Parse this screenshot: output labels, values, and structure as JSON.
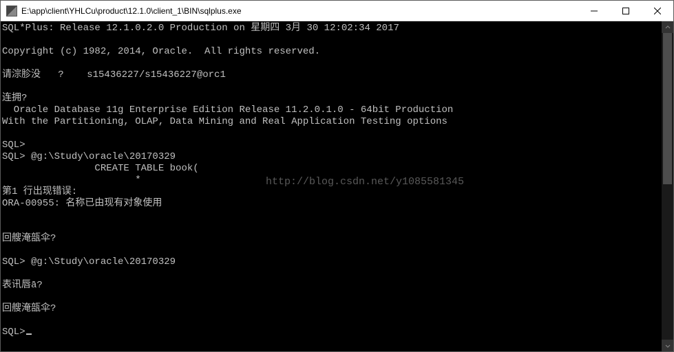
{
  "window": {
    "title": "E:\\app\\client\\YHLCu\\product\\12.1.0\\client_1\\BIN\\sqlplus.exe"
  },
  "watermark": "http://blog.csdn.net/y1085581345",
  "lines": {
    "l0": "SQL*Plus: Release 12.1.0.2.0 Production on 星期四 3月 30 12:02:34 2017",
    "l1": "",
    "l2": "Copyright (c) 1982, 2014, Oracle.  All rights reserved.",
    "l3": "",
    "l4": "请淙胗没   ?    s15436227/s15436227@orc1",
    "l5": "",
    "l6": "连拥?",
    "l7": "  Oracle Database 11g Enterprise Edition Release 11.2.0.1.0 - 64bit Production",
    "l8": "With the Partitioning, OLAP, Data Mining and Real Application Testing options",
    "l9": "",
    "l10": "SQL>",
    "l11": "SQL> @g:\\Study\\oracle\\20170329",
    "l12": "                CREATE TABLE book(",
    "l13": "                       *",
    "l14": "第1 行出现错误:",
    "l15": "ORA-00955: 名称已由现有对象使用",
    "l16": "",
    "l17": "",
    "l18": "回艘淹瓿伞?",
    "l19": "",
    "l20": "SQL> @g:\\Study\\oracle\\20170329",
    "l21": "",
    "l22": "表讯唇ā?",
    "l23": "",
    "l24": "回艘淹瓿伞?",
    "l25": "",
    "l26": "SQL>"
  }
}
